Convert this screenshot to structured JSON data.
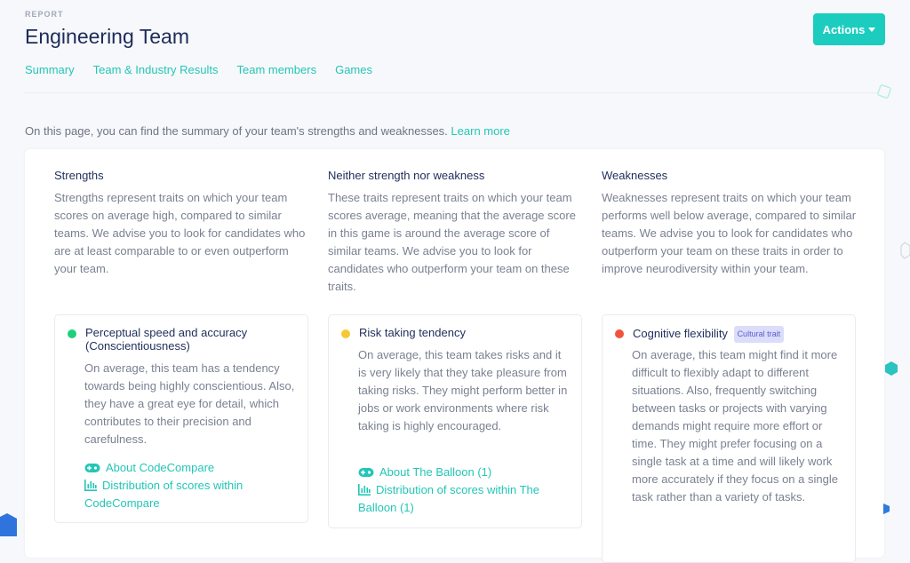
{
  "header": {
    "eyebrow": "REPORT",
    "title": "Engineering Team",
    "actions_label": "Actions"
  },
  "tabs": [
    {
      "label": "Summary"
    },
    {
      "label": "Team & Industry Results"
    },
    {
      "label": "Team members"
    },
    {
      "label": "Games"
    }
  ],
  "intro": {
    "text": "On this page, you can find the summary of your team's strengths and weaknesses.",
    "link": "Learn more"
  },
  "columns": [
    {
      "title": "Strengths",
      "description": "Strengths represent traits on which your team scores on average high, compared to similar teams. We advise you to look for candidates who are at least comparable to or even outperform your team.",
      "trait": {
        "name": "Perceptual speed and accuracy (Conscientiousness)",
        "status_color": "#1ed07a",
        "badge": null,
        "text": "On average, this team has a tendency towards being highly conscientious. Also, they have a great eye for detail, which contributes to their precision and carefulness.",
        "about_link": "About CodeCompare",
        "distribution_link": "Distribution of scores within CodeCompare"
      }
    },
    {
      "title": "Neither strength nor weakness",
      "description": "These traits represent traits on which your team scores average, meaning that the average score in this game is around the average score of similar teams. We advise you to look for candidates who outperform your team on these traits.",
      "trait": {
        "name": "Risk taking tendency",
        "status_color": "#f5c935",
        "badge": null,
        "text": "On average, this team takes risks and it is very likely that they take pleasure from taking risks. They might perform better in jobs or work environments where risk taking is highly encouraged.",
        "about_link": "About The Balloon (1)",
        "distribution_link": "Distribution of scores within The Balloon (1)"
      }
    },
    {
      "title": "Weaknesses",
      "description": "Weaknesses represent traits on which your team performs well below average, compared to similar teams. We advise you to look for candidates who outperform your team on these traits in order to improve neurodiversity within your team.",
      "trait": {
        "name": "Cognitive flexibility",
        "status_color": "#f0543c",
        "badge": "Cultural trait",
        "text": "On average, this team might find it more difficult to flexibly adapt to different situations. Also, frequently switching between tasks or projects with varying demands might require more effort or time. They might prefer focusing on a single task at a time and will likely work more accurately if they focus on a single task rather than a variety of tasks."
      }
    }
  ],
  "colors": {
    "accent": "#1ccdbf",
    "link": "#23c6b6",
    "title": "#1c2b59",
    "body_text": "#7a8191"
  }
}
